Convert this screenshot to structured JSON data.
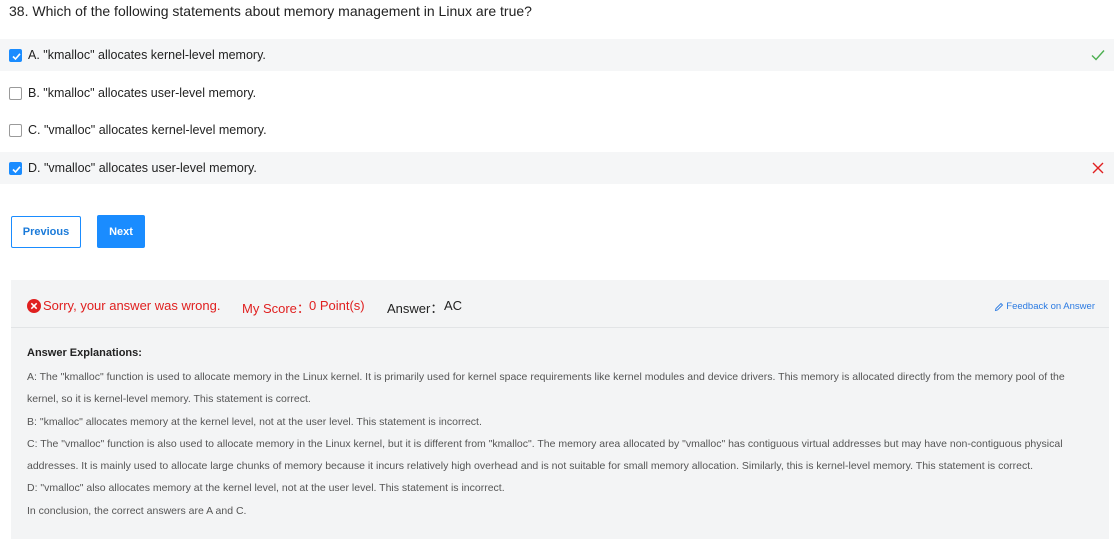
{
  "question": {
    "title": "38. Which of the following statements about memory management in Linux are true?"
  },
  "options": [
    {
      "label": "A. \"kmalloc\" allocates kernel-level memory.",
      "checked": true,
      "mark": "correct-check-icon"
    },
    {
      "label": "B. \"kmalloc\" allocates user-level memory.",
      "checked": false
    },
    {
      "label": "C. \"vmalloc\" allocates kernel-level memory.",
      "checked": false
    },
    {
      "label": "D. \"vmalloc\" allocates user-level memory.",
      "checked": true,
      "mark": "wrong-x-icon"
    }
  ],
  "nav": {
    "previous_label": "Previous",
    "next_label": "Next"
  },
  "result": {
    "wrong_text": "Sorry, your answer was wrong.",
    "score_label": "My Score：",
    "score_value": "0 Point(s)",
    "answer_label": "Answer：",
    "answer_value": "AC",
    "feedback_label": "Feedback on Answer"
  },
  "explanation": {
    "title": "Answer Explanations:",
    "paragraphs": [
      "A: The \"kmalloc\" function is used to allocate memory in the Linux kernel. It is primarily used for kernel space requirements like kernel modules and device drivers. This memory is allocated directly from the memory pool of the kernel, so it is kernel-level memory. This statement is correct.",
      "B: \"kmalloc\" allocates memory at the kernel level, not at the user level. This statement is incorrect.",
      "C: The \"vmalloc\" function is also used to allocate memory in the Linux kernel, but it is different from \"kmalloc\". The memory area allocated by \"vmalloc\" has contiguous virtual addresses but may have non-contiguous physical addresses. It is mainly used to allocate large chunks of memory because it incurs relatively high overhead and is not suitable for small memory allocation. Similarly, this is kernel-level memory. This statement is correct.",
      "D: \"vmalloc\" also allocates memory at the kernel level, not at the user level. This statement is incorrect.",
      "In conclusion, the correct answers are A and C."
    ]
  },
  "colors": {
    "accent": "#1a8cff",
    "correct": "#4caf50",
    "wrong": "#e02020"
  }
}
